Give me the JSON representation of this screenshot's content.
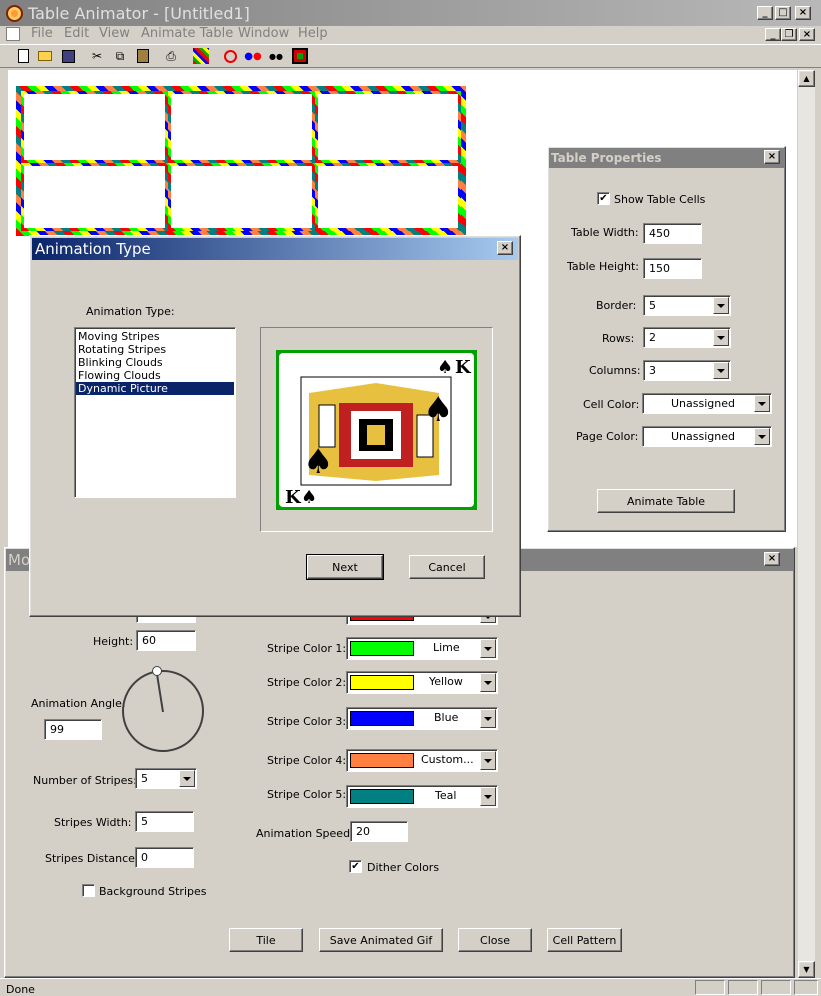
{
  "app": {
    "title": "Table Animator - [Untitled1]",
    "menu": [
      "File",
      "Edit",
      "View",
      "Animate Table",
      "Window",
      "Help"
    ],
    "toolbar_icons": [
      "new-icon",
      "open-icon",
      "save-icon",
      "cut-icon",
      "copy-icon",
      "paste-icon",
      "print-icon",
      "stripes-icon",
      "ring-icon",
      "dots-color-icon",
      "dots-black-icon",
      "picture-icon"
    ]
  },
  "table_properties": {
    "title": "Table Properties",
    "show_cells_label": "Show Table Cells",
    "show_cells": true,
    "width_label": "Table Width:",
    "width": "450",
    "height_label": "Table Height:",
    "height": "150",
    "border_label": "Border:",
    "border": "5",
    "rows_label": "Rows:",
    "rows": "2",
    "columns_label": "Columns:",
    "columns": "3",
    "cell_color_label": "Cell Color:",
    "cell_color": "Unassigned",
    "page_color_label": "Page Color:",
    "page_color": "Unassigned",
    "animate_button": "Animate Table"
  },
  "animation_dialog": {
    "title": "Animation Type",
    "list_label": "Animation Type:",
    "items": [
      "Moving Stripes",
      "Rotating Stripes",
      "Blinking Clouds",
      "Flowing Clouds",
      "Dynamic Picture"
    ],
    "selected": "Dynamic Picture",
    "next_button": "Next",
    "cancel_button": "Cancel"
  },
  "stripes_panel": {
    "title_partial": "Mo",
    "height_label": "Height:",
    "height": "60",
    "angle_label": "Animation Angle:",
    "angle": "99",
    "num_stripes_label": "Number of Stripes:",
    "num_stripes": "5",
    "stripes_width_label": "Stripes Width:",
    "stripes_width": "5",
    "stripes_distance_label": "Stripes Distance:",
    "stripes_distance": "0",
    "background_stripes_label": "Background Stripes",
    "background_stripes": false,
    "color0_value": "Red",
    "colors": [
      {
        "label": "Stripe Color 1:",
        "name": "Lime",
        "hex": "#00ff00"
      },
      {
        "label": "Stripe Color 2:",
        "name": "Yellow",
        "hex": "#ffff00"
      },
      {
        "label": "Stripe Color 3:",
        "name": "Blue",
        "hex": "#0000ff"
      },
      {
        "label": "Stripe Color 4:",
        "name": "Custom...",
        "hex": "#ff8040"
      },
      {
        "label": "Stripe Color 5:",
        "name": "Teal",
        "hex": "#008080"
      }
    ],
    "speed_label": "Animation Speed:",
    "speed": "20",
    "dither_label": "Dither Colors",
    "dither": true,
    "buttons": {
      "tile": "Tile",
      "save_gif": "Save Animated Gif",
      "close": "Close",
      "cell_pattern": "Cell Pattern"
    }
  },
  "status": {
    "text": "Done"
  },
  "colors": {
    "titlebar_inactive": "#808080",
    "dialog_title_start": "#0a246a",
    "dialog_title_end": "#a6caf0",
    "selection": "#0a246a"
  }
}
